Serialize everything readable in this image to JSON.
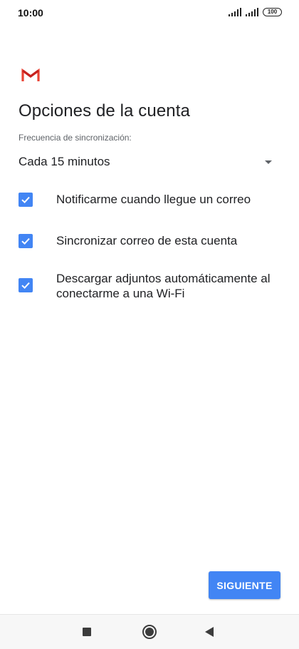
{
  "status_bar": {
    "time": "10:00",
    "battery": "100",
    "icons": [
      "signal-icon",
      "signal-icon",
      "battery-icon"
    ]
  },
  "app": {
    "logo_icon": "gmail-icon",
    "brand_colors": [
      "#EA4335",
      "#C5221F"
    ]
  },
  "page": {
    "title": "Opciones de la cuenta"
  },
  "sync_frequency": {
    "label": "Frecuencia de sincronización:",
    "selected": "Cada 15 minutos",
    "icon": "dropdown-arrow-icon"
  },
  "options": [
    {
      "label": "Notificarme cuando llegue un correo",
      "checked": true
    },
    {
      "label": "Sincronizar correo de esta cuenta",
      "checked": true
    },
    {
      "label": "Descargar adjuntos automáticamente al conectarme a una Wi-Fi",
      "checked": true
    }
  ],
  "actions": {
    "next_label": "SIGUIENTE",
    "accent_color": "#4285F4"
  },
  "nav_bar": {
    "icons": [
      "recents-square-icon",
      "home-circle-icon",
      "back-triangle-icon"
    ]
  }
}
